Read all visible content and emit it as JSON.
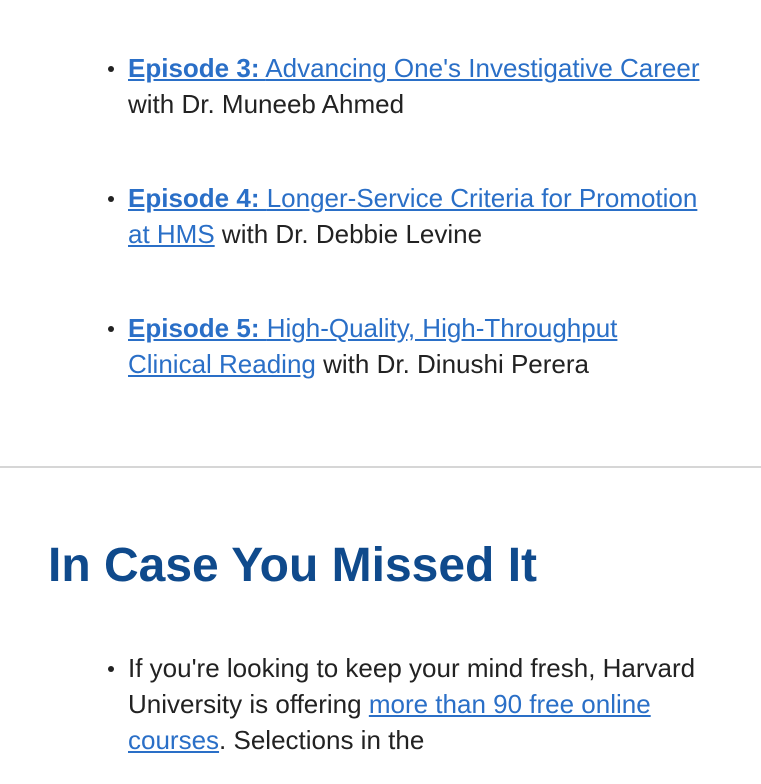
{
  "episodes": [
    {
      "label": "Episode 3:",
      "title": "Advancing One's Investigative Career",
      "suffix": "with Dr. Muneeb Ahmed"
    },
    {
      "label": "Episode 4:",
      "title": "Longer-Service Criteria for Promotion at HMS",
      "suffix": "with Dr. Debbie Levine"
    },
    {
      "label": "Episode 5:",
      "title": "High-Quality, High-Throughput Clinical Reading",
      "suffix": "with Dr. Dinushi Perera"
    }
  ],
  "section": {
    "title": "In Case You Missed It"
  },
  "icym": {
    "items": [
      {
        "before": "If you're looking to keep your mind fresh, Harvard University is offering",
        "link": "more than 90 free online courses",
        "after": ". Selections in the"
      }
    ]
  },
  "colors": {
    "link": "#2a6fc7",
    "heading": "#0f4a8c",
    "text": "#222222",
    "divider": "#d6d6d6"
  }
}
